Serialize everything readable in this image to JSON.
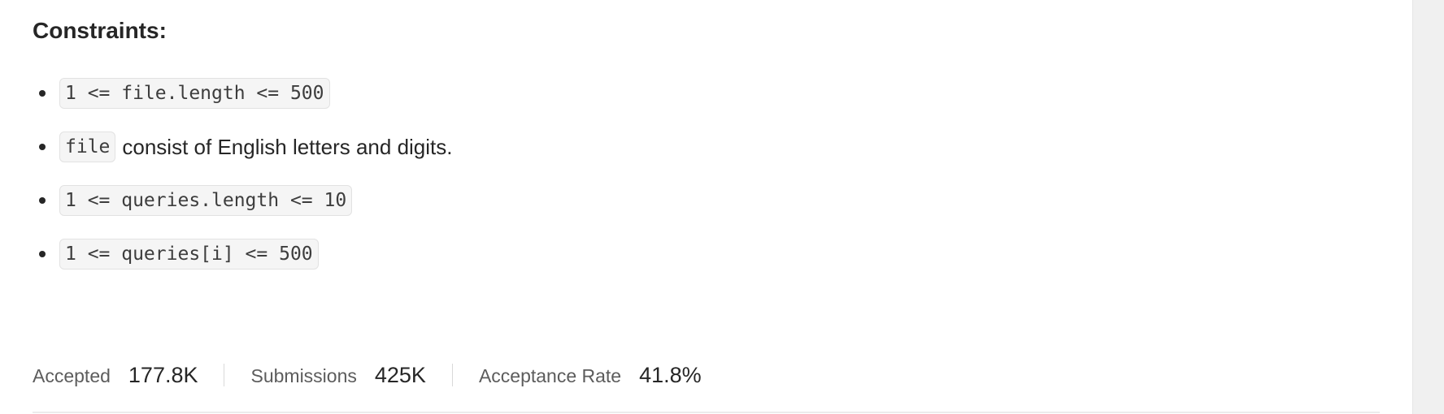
{
  "constraints": {
    "heading": "Constraints:",
    "items": [
      {
        "code": "1 <= file.length <= 500",
        "text": ""
      },
      {
        "code": "file",
        "text": "consist of English letters and digits."
      },
      {
        "code": "1 <= queries.length <= 10",
        "text": ""
      },
      {
        "code": "1 <= queries[i] <= 500",
        "text": ""
      }
    ]
  },
  "stats": {
    "accepted_label": "Accepted",
    "accepted_value": "177.8K",
    "submissions_label": "Submissions",
    "submissions_value": "425K",
    "acceptance_rate_label": "Acceptance Rate",
    "acceptance_rate_value": "41.8%"
  },
  "side_panel": {
    "handle_icon": "drag-handle-icon"
  }
}
